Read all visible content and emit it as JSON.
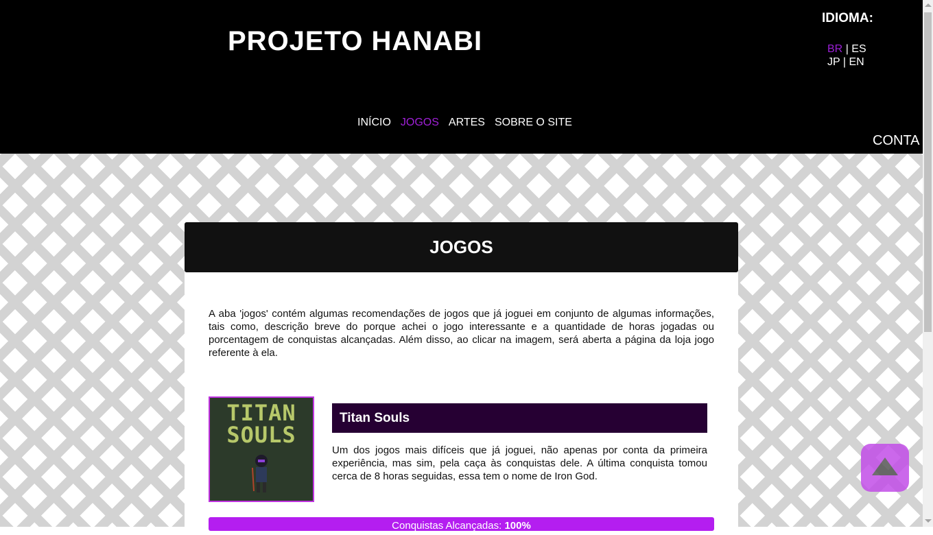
{
  "header": {
    "site_title": "PROJETO HANABI",
    "language_label": "IDIOMA:",
    "languages": [
      {
        "code": "BR",
        "active": true
      },
      {
        "code": "ES",
        "active": false
      },
      {
        "code": "JP",
        "active": false
      },
      {
        "code": "EN",
        "active": false
      }
    ],
    "separator": "|",
    "account_label": "CONTA",
    "nav": [
      {
        "label": "INÍCIO",
        "active": false
      },
      {
        "label": "JOGOS",
        "active": true
      },
      {
        "label": "ARTES",
        "active": false
      },
      {
        "label": "SOBRE O SITE",
        "active": false
      }
    ]
  },
  "section": {
    "title": "JOGOS",
    "intro": "A aba 'jogos' contém algumas recomendações de jogos que já joguei em conjunto de algumas informações, tais como, descrição breve do porque achei o jogo interessante e a quantidade de horas jogadas ou porcentagem de conquistas alcançadas. Além disso, ao clicar na imagem, será aberta a página da loja jogo referente à ela."
  },
  "games": [
    {
      "cover_text": "TITAN SOULS",
      "name": "Titan Souls",
      "description": "Um dos jogos mais difíceis que já joguei, não apenas por conta da primeira experiência, mas sim, pela caça às conquistas dele. A última conquista tomou cerca de 8 horas seguidas, essa tem o nome de Iron God.",
      "achievements_label": "Conquistas Alcançadas:",
      "achievements_value": "100%"
    }
  ],
  "colors": {
    "header_bg": "#000000",
    "accent_purple": "#a020d8",
    "game_title_bar": "#260033",
    "achievements_bar": "#b41ef0",
    "back_to_top": "#c24ee8"
  },
  "icons": {
    "back_to_top": "up-triangle-icon"
  }
}
